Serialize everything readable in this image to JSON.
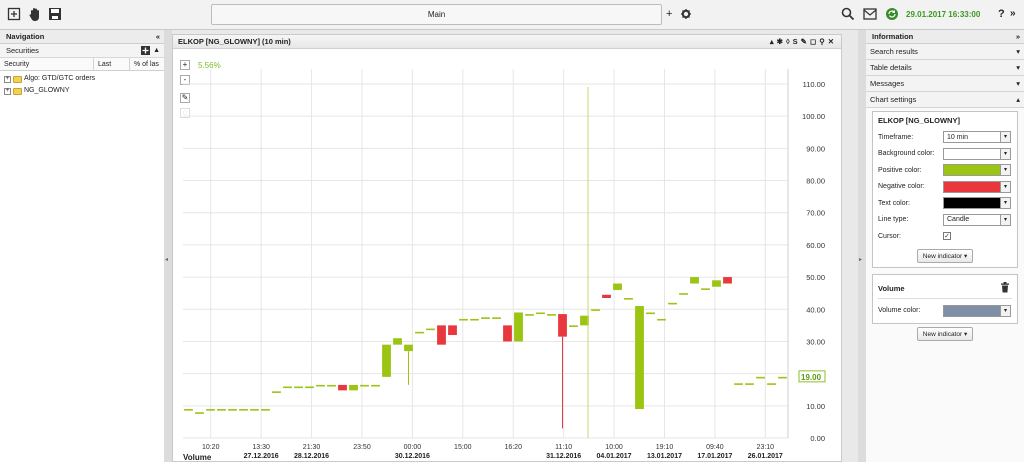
{
  "topbar": {
    "main_tab_label": "Main",
    "add_tab": "+",
    "clock": "29.01.2017 16:33:00",
    "help": "?",
    "more": "»"
  },
  "navigation": {
    "title": "Navigation",
    "collapse": "«",
    "securities_label": "Securities",
    "columns": [
      "Security",
      "Last",
      "% of las"
    ],
    "tree_items": [
      "Algo: GTD/GTC orders",
      "NG_GLOWNY"
    ]
  },
  "chart_window": {
    "title": "ELKOP [NG_GLOWNY] (10 min)",
    "change_label": "5.56%",
    "current_price": "19.00",
    "volume_label": "Volume",
    "colors": {
      "positive": "#9bc413",
      "negative": "#e8383d",
      "grid": "#e6e6e6",
      "cursor": "#c8d96a",
      "change": "#7cbc2a"
    }
  },
  "chart_data": {
    "type": "candlestick",
    "ylim": [
      0,
      110
    ],
    "y_ticks": [
      "0.00",
      "10.00",
      "20.00",
      "30.00",
      "40.00",
      "50.00",
      "60.00",
      "70.00",
      "80.00",
      "90.00",
      "100.00",
      "110.00"
    ],
    "x_time_labels": [
      "10:20",
      "13:30",
      "21:30",
      "23:50",
      "00:00",
      "15:00",
      "16:20",
      "11:10",
      "10:00",
      "19:10",
      "09:40",
      "23:10"
    ],
    "x_date_labels": [
      "27.12.2016",
      "28.12.2016",
      "30.12.2016",
      "31.12.2016",
      "04.01.2017",
      "13.01.2017",
      "17.01.2017",
      "26.01.2017"
    ],
    "candles": [
      {
        "o": 9.0,
        "c": 9.0
      },
      {
        "o": 8.0,
        "c": 8.0
      },
      {
        "o": 9.0,
        "c": 9.0
      },
      {
        "o": 9.0,
        "c": 9.0
      },
      {
        "o": 9.0,
        "c": 9.0
      },
      {
        "o": 9.0,
        "c": 9.0
      },
      {
        "o": 9.0,
        "c": 9.0
      },
      {
        "o": 9.0,
        "c": 9.0
      },
      {
        "o": 14.5,
        "c": 14.5
      },
      {
        "o": 16.0,
        "c": 16.0
      },
      {
        "o": 16.0,
        "c": 16.0
      },
      {
        "o": 16.0,
        "c": 16.0
      },
      {
        "o": 16.5,
        "c": 16.5
      },
      {
        "o": 16.5,
        "c": 16.5
      },
      {
        "o": 16.5,
        "c": 14.8
      },
      {
        "o": 14.8,
        "c": 16.5
      },
      {
        "o": 16.5,
        "c": 16.5
      },
      {
        "o": 16.5,
        "c": 16.5
      },
      {
        "o": 19.0,
        "c": 29.0
      },
      {
        "o": 29.0,
        "c": 31.0
      },
      {
        "o": 27.0,
        "c": 29.0,
        "l": 16.5
      },
      {
        "o": 33.0,
        "c": 33.0
      },
      {
        "o": 34.0,
        "c": 34.0
      },
      {
        "o": 35.0,
        "c": 29.0
      },
      {
        "o": 35.0,
        "c": 32.0
      },
      {
        "o": 37.0,
        "c": 37.0
      },
      {
        "o": 37.0,
        "c": 37.0
      },
      {
        "o": 37.5,
        "c": 37.5
      },
      {
        "o": 37.5,
        "c": 37.5
      },
      {
        "o": 35.0,
        "c": 30.0
      },
      {
        "o": 30.0,
        "c": 39.0
      },
      {
        "o": 38.5,
        "c": 38.5
      },
      {
        "o": 39.0,
        "c": 39.0
      },
      {
        "o": 38.5,
        "c": 38.5
      },
      {
        "o": 38.5,
        "c": 31.5,
        "l": 3.0
      },
      {
        "o": 35.0,
        "c": 35.0
      },
      {
        "o": 35.0,
        "c": 38.0
      },
      {
        "o": 40.0,
        "c": 40.0
      },
      {
        "o": 44.5,
        "c": 43.5
      },
      {
        "o": 46.0,
        "c": 48.0
      },
      {
        "o": 43.5,
        "c": 43.5
      },
      {
        "o": 9.0,
        "c": 41.0
      },
      {
        "o": 39.0,
        "c": 39.0
      },
      {
        "o": 37.0,
        "c": 37.0
      },
      {
        "o": 42.0,
        "c": 42.0
      },
      {
        "o": 45.0,
        "c": 45.0
      },
      {
        "o": 48.0,
        "c": 50.0
      },
      {
        "o": 46.5,
        "c": 46.5
      },
      {
        "o": 47.0,
        "c": 49.0
      },
      {
        "o": 50.0,
        "c": 48.0
      },
      {
        "o": 17.0,
        "c": 17.0
      },
      {
        "o": 17.0,
        "c": 17.0
      },
      {
        "o": 19.0,
        "c": 19.0
      },
      {
        "o": 17.0,
        "c": 17.0
      },
      {
        "o": 19.0,
        "c": 19.0
      }
    ]
  },
  "information": {
    "title": "Information",
    "more": "»",
    "sections": [
      "Search results",
      "Table details",
      "Messages",
      "Chart settings"
    ],
    "chart_settings": {
      "security": "ELKOP [NG_GLOWNY]",
      "timeframe_label": "Timeframe:",
      "timeframe_value": "10 min",
      "background_label": "Background color:",
      "positive_label": "Positive color:",
      "negative_label": "Negative color:",
      "text_label": "Text color:",
      "line_type_label": "Line type:",
      "line_type_value": "Candle",
      "cursor_label": "Cursor:",
      "new_indicator": "New indicator ▾",
      "colors": {
        "background": "#ffffff",
        "positive": "#9bc413",
        "negative": "#e8383d",
        "text": "#000000"
      }
    },
    "volume_box": {
      "title": "Volume",
      "color_label": "Volume color:",
      "color": "#7f8fa8",
      "new_indicator": "New indicator ▾"
    }
  }
}
